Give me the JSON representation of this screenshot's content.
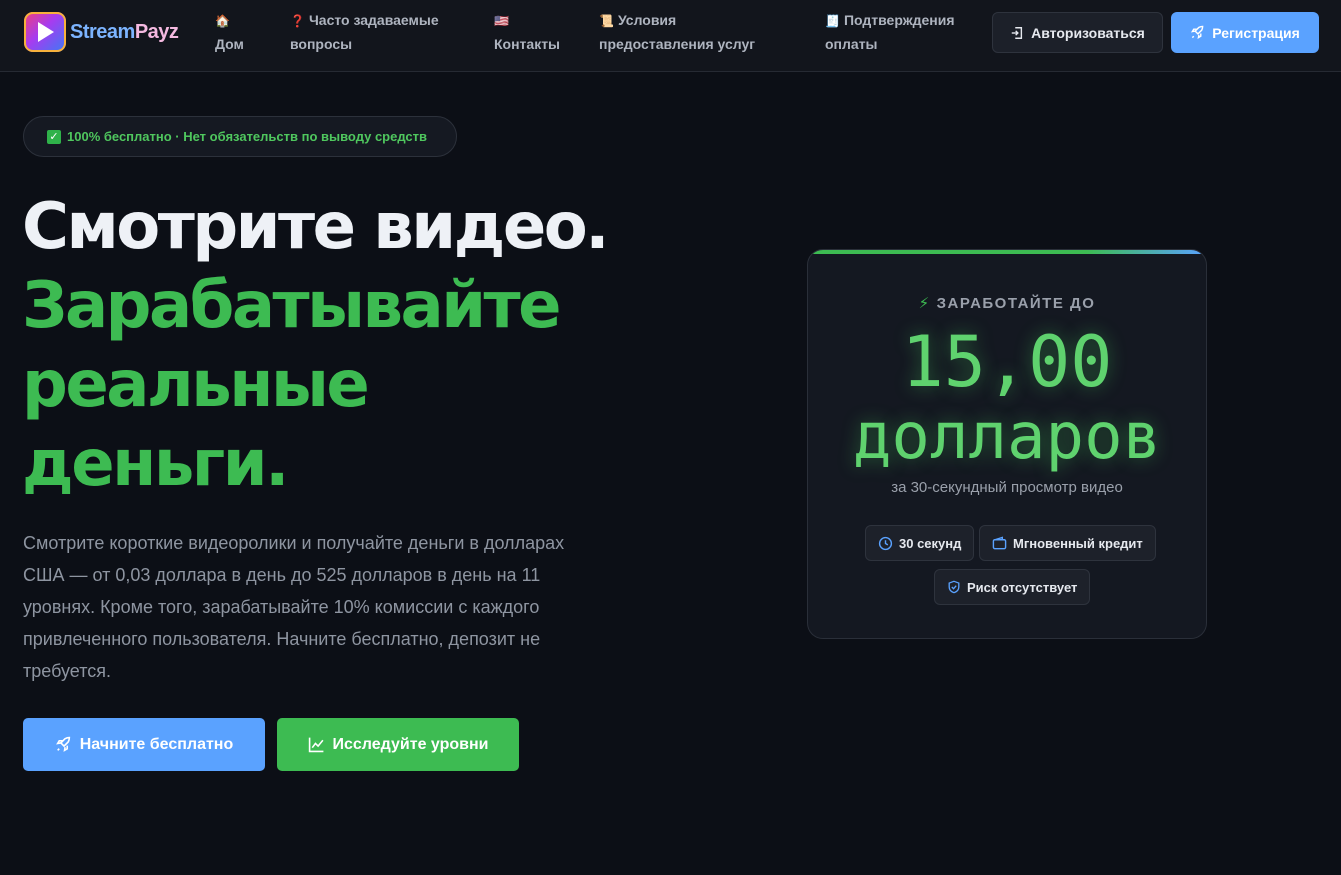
{
  "brand": {
    "name_part1": "Stream",
    "name_part2": "Payz"
  },
  "nav": {
    "items": [
      {
        "icon": "🏠",
        "label": "Дом"
      },
      {
        "icon": "❓",
        "label": "Часто задаваемые вопросы"
      },
      {
        "icon": "🇺🇸",
        "label": "Контакты"
      },
      {
        "icon": "📜",
        "label": "Условия предоставления услуг"
      },
      {
        "icon": "🧾",
        "label": "Подтверждения оплаты"
      }
    ],
    "login_label": "Авторизоваться",
    "register_label": "Регистрация"
  },
  "hero": {
    "badge": "100% бесплатно · Нет обязательств по выводу средств",
    "headline_white": "Смотрите видео.",
    "headline_green_1": "Зарабатывайте",
    "headline_green_2": "реальные",
    "headline_green_3": "деньги.",
    "lead": "Смотрите короткие видеоролики и получайте деньги в долларах США — от 0,03 доллара в день до 525 долларов в день на 11 уровнях. Кроме того, зарабатывайте 10% комиссии с каждого привлеченного пользователя. Начните бесплатно, депозит не требуется.",
    "cta_start": "Начните бесплатно",
    "cta_levels": "Исследуйте уровни"
  },
  "earn_card": {
    "label": "ЗАРАБОТАЙТЕ ДО",
    "amount": "15,00",
    "unit": "долларов",
    "note": "за 30-секундный просмотр видео",
    "chips": {
      "seconds": "30 секунд",
      "instant": "Мгновенный кредит",
      "risk": "Риск отсутствует"
    }
  },
  "colors": {
    "accent_green": "#3dbb52",
    "accent_blue": "#5aa2ff",
    "background": "#0c0f16"
  },
  "icons": {
    "login": "sign-in-icon",
    "register": "rocket-icon",
    "cta_start": "rocket-icon",
    "cta_levels": "chart-line-icon",
    "earn_label": "bolt-icon",
    "chip_seconds": "clock-icon",
    "chip_instant": "wallet-icon",
    "chip_risk": "shield-icon"
  }
}
